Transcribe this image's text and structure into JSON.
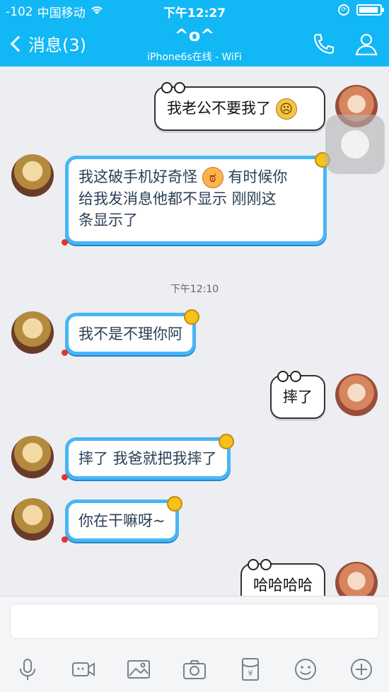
{
  "status_bar": {
    "signal": "-102",
    "carrier": "中国移动",
    "time": "下午12:27"
  },
  "nav": {
    "back_label": "消息(3)",
    "title": "^o^",
    "subtitle": "iPhone6s在线 - WiFi"
  },
  "messages": [
    {
      "side": "out",
      "text": "我老公不要我了",
      "emoji": "sad"
    },
    {
      "side": "in",
      "text_line1": "我这破手机好奇怪",
      "text_line1b": "有时候你",
      "text_line2": "给我发消息他都不显示  刚刚这",
      "text_line3": "条显示了",
      "emoji": "angry"
    },
    {
      "side": "in",
      "text": "我不是不理你阿"
    },
    {
      "side": "out",
      "text": "摔了"
    },
    {
      "side": "in",
      "text": "摔了 我爸就把我摔了"
    },
    {
      "side": "in",
      "text": "你在干嘛呀~"
    },
    {
      "side": "out",
      "text": "哈哈哈哈"
    }
  ],
  "divider_time": "下午12:10",
  "icons": {
    "toolbar": [
      "microphone-icon",
      "video-call-icon",
      "image-icon",
      "camera-icon",
      "red-packet-icon",
      "emoji-icon",
      "add-icon"
    ]
  },
  "colors": {
    "header_blue": "#12b7f5",
    "bubble_border_blue": "#48b6f5",
    "background": "#eceef2"
  }
}
